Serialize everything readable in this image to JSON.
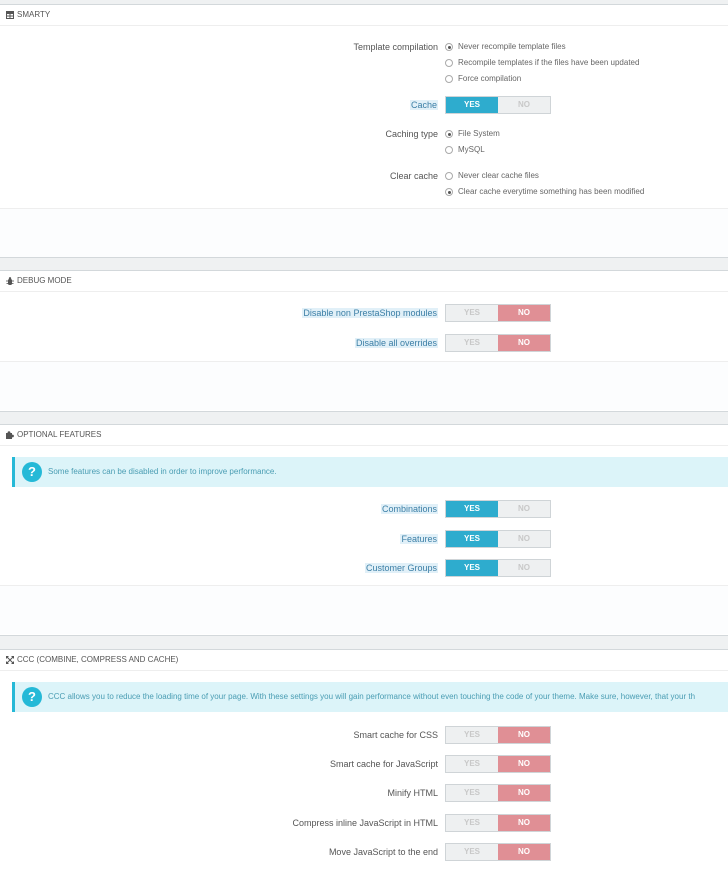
{
  "smarty": {
    "title": "SMARTY",
    "template_compilation": {
      "label": "Template compilation",
      "options": [
        "Never recompile template files",
        "Recompile templates if the files have been updated",
        "Force compilation"
      ],
      "selected": 0
    },
    "cache": {
      "label": "Cache",
      "yes": "YES",
      "no": "NO",
      "value": "YES"
    },
    "caching_type": {
      "label": "Caching type",
      "options": [
        "File System",
        "MySQL"
      ],
      "selected": 0
    },
    "clear_cache": {
      "label": "Clear cache",
      "options": [
        "Never clear cache files",
        "Clear cache everytime something has been modified"
      ],
      "selected": 1
    }
  },
  "debug": {
    "title": "DEBUG MODE",
    "disable_modules": {
      "label": "Disable non PrestaShop modules",
      "yes": "YES",
      "no": "NO",
      "value": "NO"
    },
    "disable_overrides": {
      "label": "Disable all overrides",
      "yes": "YES",
      "no": "NO",
      "value": "NO"
    }
  },
  "optional": {
    "title": "OPTIONAL FEATURES",
    "alert": "Some features can be disabled in order to improve performance.",
    "combinations": {
      "label": "Combinations",
      "yes": "YES",
      "no": "NO",
      "value": "YES"
    },
    "features": {
      "label": "Features",
      "yes": "YES",
      "no": "NO",
      "value": "YES"
    },
    "customer_groups": {
      "label": "Customer Groups",
      "yes": "YES",
      "no": "NO",
      "value": "YES"
    }
  },
  "ccc": {
    "title": "CCC (COMBINE, COMPRESS AND CACHE)",
    "alert": "CCC allows you to reduce the loading time of your page. With these settings you will gain performance without even touching the code of your theme. Make sure, however, that your th",
    "css": {
      "label": "Smart cache for CSS",
      "yes": "YES",
      "no": "NO",
      "value": "NO"
    },
    "js": {
      "label": "Smart cache for JavaScript",
      "yes": "YES",
      "no": "NO",
      "value": "NO"
    },
    "html": {
      "label": "Minify HTML",
      "yes": "YES",
      "no": "NO",
      "value": "NO"
    },
    "inline_js": {
      "label": "Compress inline JavaScript in HTML",
      "yes": "YES",
      "no": "NO",
      "value": "NO"
    },
    "move_js": {
      "label": "Move JavaScript to the end",
      "yes": "YES",
      "no": "NO",
      "value": "NO"
    }
  },
  "icons": {
    "smarty": "table-icon",
    "debug": "bug-icon",
    "optional": "puzzle-icon",
    "ccc": "fullscreen-icon",
    "alert": "question-icon"
  }
}
